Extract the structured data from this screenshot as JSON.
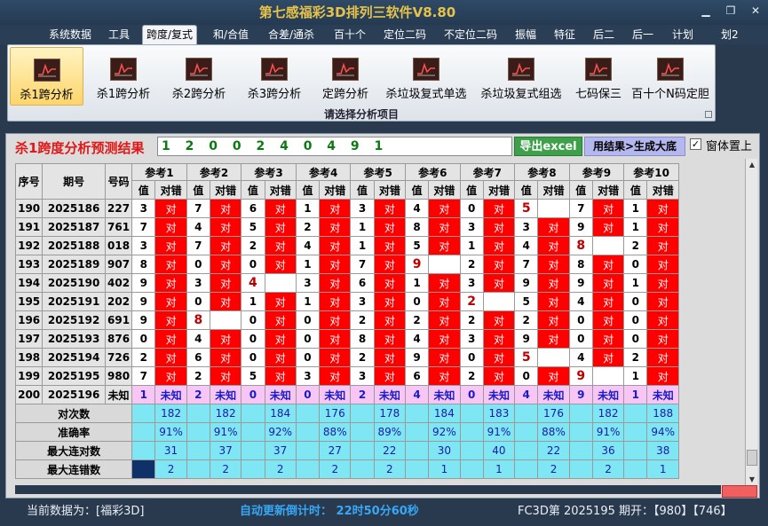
{
  "window": {
    "title": "第七感福彩3D排列三软件V8.80"
  },
  "menu": [
    "系统数据",
    "工具",
    "跨度/复式",
    "和/合值",
    "合差/通杀",
    "百十个",
    "定位二码",
    "不定位二码",
    "振幅",
    "特征",
    "后二",
    "后一",
    "计划",
    "划2"
  ],
  "menu_active": "跨度/复式",
  "ribbon": {
    "buttons": [
      "杀1跨分析",
      "杀1跨分析",
      "杀2跨分析",
      "杀3跨分析",
      "定跨分析",
      "杀垃圾复式单选",
      "杀垃圾复式组选",
      "七码保三",
      "百十个N码定胆"
    ],
    "selected_index": 0,
    "icon": "chart-icon",
    "group_label": "请选择分析项目"
  },
  "analysis": {
    "heading": "杀1跨度分析预测结果",
    "result": "1 2 0 0 2 4 0 4 9 1",
    "export_button": "导出excel",
    "generate_button": "用结果>生成大底",
    "topmost_checkbox": {
      "checked": true,
      "label": "窗体置上",
      "mark": "✓"
    }
  },
  "table": {
    "headers": {
      "seq": "序号",
      "period": "期号",
      "number": "号码"
    },
    "ref_headers": [
      "参考1",
      "参考2",
      "参考3",
      "参考4",
      "参考5",
      "参考6",
      "参考7",
      "参考8",
      "参考9",
      "参考10"
    ],
    "sub_headers": [
      "值",
      "对错"
    ],
    "rows": [
      {
        "seq": "190",
        "period": "2025186",
        "num": "227",
        "vals": [
          "3",
          "7",
          "6",
          "1",
          "3",
          "4",
          "0",
          "5",
          "7",
          "1"
        ],
        "hits": [
          true,
          true,
          true,
          true,
          true,
          true,
          true,
          false,
          true,
          true
        ]
      },
      {
        "seq": "191",
        "period": "2025187",
        "num": "761",
        "vals": [
          "7",
          "4",
          "5",
          "2",
          "1",
          "8",
          "3",
          "3",
          "9",
          "1"
        ],
        "hits": [
          true,
          true,
          true,
          true,
          true,
          true,
          true,
          true,
          true,
          true
        ]
      },
      {
        "seq": "192",
        "period": "2025188",
        "num": "018",
        "vals": [
          "3",
          "7",
          "2",
          "4",
          "1",
          "5",
          "1",
          "4",
          "8",
          "2"
        ],
        "hits": [
          true,
          true,
          true,
          true,
          true,
          true,
          true,
          true,
          false,
          true
        ]
      },
      {
        "seq": "193",
        "period": "2025189",
        "num": "907",
        "vals": [
          "8",
          "0",
          "0",
          "1",
          "7",
          "9",
          "2",
          "7",
          "8",
          "0"
        ],
        "hits": [
          true,
          true,
          true,
          true,
          true,
          false,
          true,
          true,
          true,
          true
        ]
      },
      {
        "seq": "194",
        "period": "2025190",
        "num": "402",
        "vals": [
          "9",
          "3",
          "4",
          "3",
          "6",
          "1",
          "3",
          "9",
          "9",
          "1"
        ],
        "hits": [
          true,
          true,
          false,
          true,
          true,
          true,
          true,
          true,
          true,
          true
        ]
      },
      {
        "seq": "195",
        "period": "2025191",
        "num": "202",
        "vals": [
          "9",
          "0",
          "1",
          "1",
          "3",
          "0",
          "2",
          "5",
          "4",
          "0"
        ],
        "hits": [
          true,
          true,
          true,
          true,
          true,
          true,
          false,
          true,
          true,
          true
        ]
      },
      {
        "seq": "196",
        "period": "2025192",
        "num": "691",
        "vals": [
          "9",
          "8",
          "0",
          "0",
          "2",
          "2",
          "2",
          "2",
          "0",
          "0"
        ],
        "hits": [
          true,
          false,
          true,
          true,
          true,
          true,
          true,
          true,
          true,
          true
        ]
      },
      {
        "seq": "197",
        "period": "2025193",
        "num": "876",
        "vals": [
          "0",
          "4",
          "0",
          "0",
          "8",
          "4",
          "3",
          "9",
          "0",
          "0"
        ],
        "hits": [
          true,
          true,
          true,
          true,
          true,
          true,
          true,
          true,
          true,
          true
        ]
      },
      {
        "seq": "198",
        "period": "2025194",
        "num": "726",
        "vals": [
          "2",
          "6",
          "0",
          "0",
          "2",
          "9",
          "0",
          "5",
          "4",
          "2"
        ],
        "hits": [
          true,
          true,
          true,
          true,
          true,
          true,
          true,
          false,
          true,
          true
        ]
      },
      {
        "seq": "199",
        "period": "2025195",
        "num": "980",
        "vals": [
          "7",
          "2",
          "5",
          "3",
          "3",
          "6",
          "2",
          "0",
          "9",
          "1"
        ],
        "hits": [
          true,
          true,
          true,
          true,
          true,
          true,
          true,
          true,
          false,
          true
        ]
      }
    ],
    "pending_row": {
      "seq": "200",
      "period": "2025196",
      "num": "未知",
      "vals": [
        "1",
        "2",
        "0",
        "0",
        "2",
        "4",
        "0",
        "4",
        "9",
        "1"
      ],
      "status": "未知"
    },
    "stats": [
      {
        "label": "对次数",
        "values": [
          "182",
          "182",
          "184",
          "176",
          "178",
          "184",
          "183",
          "176",
          "182",
          "188"
        ]
      },
      {
        "label": "准确率",
        "values": [
          "91%",
          "91%",
          "92%",
          "88%",
          "89%",
          "92%",
          "91%",
          "88%",
          "91%",
          "94%"
        ]
      },
      {
        "label": "最大连对数",
        "values": [
          "31",
          "37",
          "37",
          "27",
          "22",
          "30",
          "40",
          "22",
          "36",
          "38"
        ]
      },
      {
        "label": "最大连错数",
        "values": [
          "2",
          "2",
          "2",
          "2",
          "2",
          "1",
          "1",
          "2",
          "2",
          "1"
        ]
      }
    ],
    "hit_mark": "对",
    "hit_color": "#ff0000",
    "pending_color": "#f7c6f4",
    "stats_color": "#7fe6f4"
  },
  "status": {
    "current": "当前数据为：[福彩3D]",
    "countdown": "自动更新倒计时：  22时50分60秒",
    "draw": "FC3D第 2025195 期开：【980】【746】"
  }
}
